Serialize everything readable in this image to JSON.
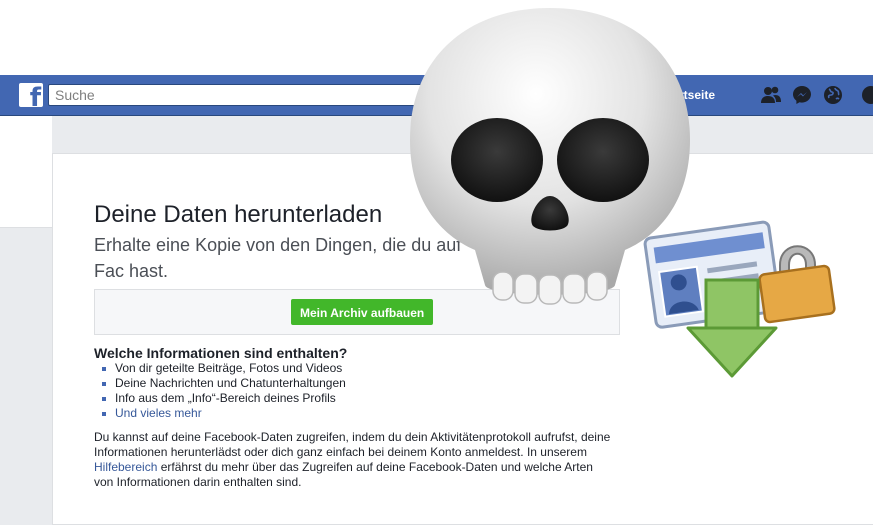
{
  "header": {
    "search_placeholder": "Suche",
    "home_label": "rtseite",
    "brand_color": "#4267b2"
  },
  "icons": {
    "logo": "facebook-logo",
    "friends": "friends-icon",
    "messenger": "messenger-icon",
    "notifications": "globe-icon",
    "overlay_skull": "skull-emoji",
    "overlay_archive": "download-archive-icon"
  },
  "main": {
    "title": "Deine Daten herunterladen",
    "subtitle": "Erhalte eine Kopie von den Dingen, die du auf Fac hast.",
    "archive_button": "Mein Archiv aufbauen",
    "button_color": "#42b72a",
    "info_heading": "Welche Informationen sind enthalten?",
    "info_items": [
      "Von dir geteilte Beiträge, Fotos und Videos",
      "Deine Nachrichten und Chatunterhaltungen",
      "Info aus dem „Info“-Bereich deines Profils",
      "Und vieles mehr"
    ],
    "paragraph_part1": "Du kannst auf deine Facebook-Daten zugreifen, indem du dein Aktivitätenprotokoll aufrufst, deine Informationen herunterlädst oder dich ganz einfach bei deinem Konto anmeldest. In unserem",
    "paragraph_link": "Hilfebereich",
    "paragraph_part2": "erfährst du mehr über das Zugreifen auf deine Facebook-Daten und welche Arten von Informationen darin enthalten sind."
  }
}
